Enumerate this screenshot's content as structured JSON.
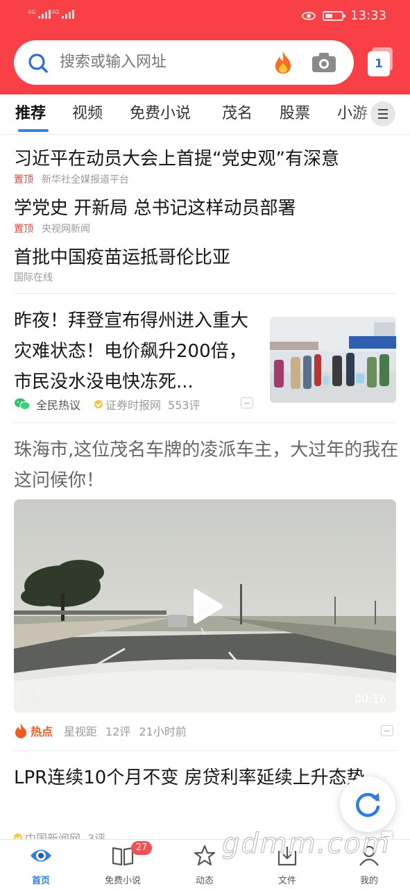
{
  "status_bar": {
    "network_1": "4G",
    "network_2": "4G",
    "time": "13:33"
  },
  "search": {
    "placeholder": "搜索或输入网址",
    "tab_count": "1"
  },
  "channels": [
    {
      "label": "推荐",
      "active": true
    },
    {
      "label": "视频"
    },
    {
      "label": "免费小说"
    },
    {
      "label": "茂名"
    },
    {
      "label": "股票"
    },
    {
      "label": "小游"
    }
  ],
  "pinned": [
    {
      "title": "习近平在动员大会上首提“党史观”有深意",
      "tag": "置顶",
      "source": "新华社全媒报道平台"
    },
    {
      "title": "学党史 开新局 总书记这样动员部署",
      "tag": "置顶",
      "source": "央视网新闻"
    },
    {
      "title": "首批中国疫苗运抵哥伦比亚",
      "tag": "",
      "source": "国际在线"
    }
  ],
  "story": {
    "title": "昨夜！拜登宣布得州进入重大灾难状态！电价飙升200倍，市民没水没电快冻死...",
    "hot_label": "全民热议",
    "source": "证券时报网",
    "comments": "553评"
  },
  "video": {
    "title": "珠海市,这位茂名车牌的凌派车主，大过年的我在这问候你！",
    "duration": "00:16",
    "stamp": "2021/02/2",
    "brand_line1": "360",
    "brand_line2": "智能云镜",
    "hot_tag": "热点",
    "source": "星视距",
    "comments": "12评",
    "time_ago": "21小时前"
  },
  "last_story": {
    "title": "LPR连续10个月不变 房贷利率延续上升态势",
    "source": "中国新闻网",
    "comments": "3评"
  },
  "bottom_nav": [
    {
      "label": "首页",
      "icon": "home-eye-icon",
      "active": true
    },
    {
      "label": "免费小说",
      "icon": "book-icon",
      "badge": "27"
    },
    {
      "label": "动态",
      "icon": "star-icon"
    },
    {
      "label": "文件",
      "icon": "download-icon"
    },
    {
      "label": "我的",
      "icon": "user-icon"
    }
  ],
  "watermark": "gdmm.com",
  "colors": {
    "header_red": "#f84046",
    "accent_blue": "#3282f0",
    "pin_red": "#e0453f",
    "hot_orange": "#f25a23"
  }
}
